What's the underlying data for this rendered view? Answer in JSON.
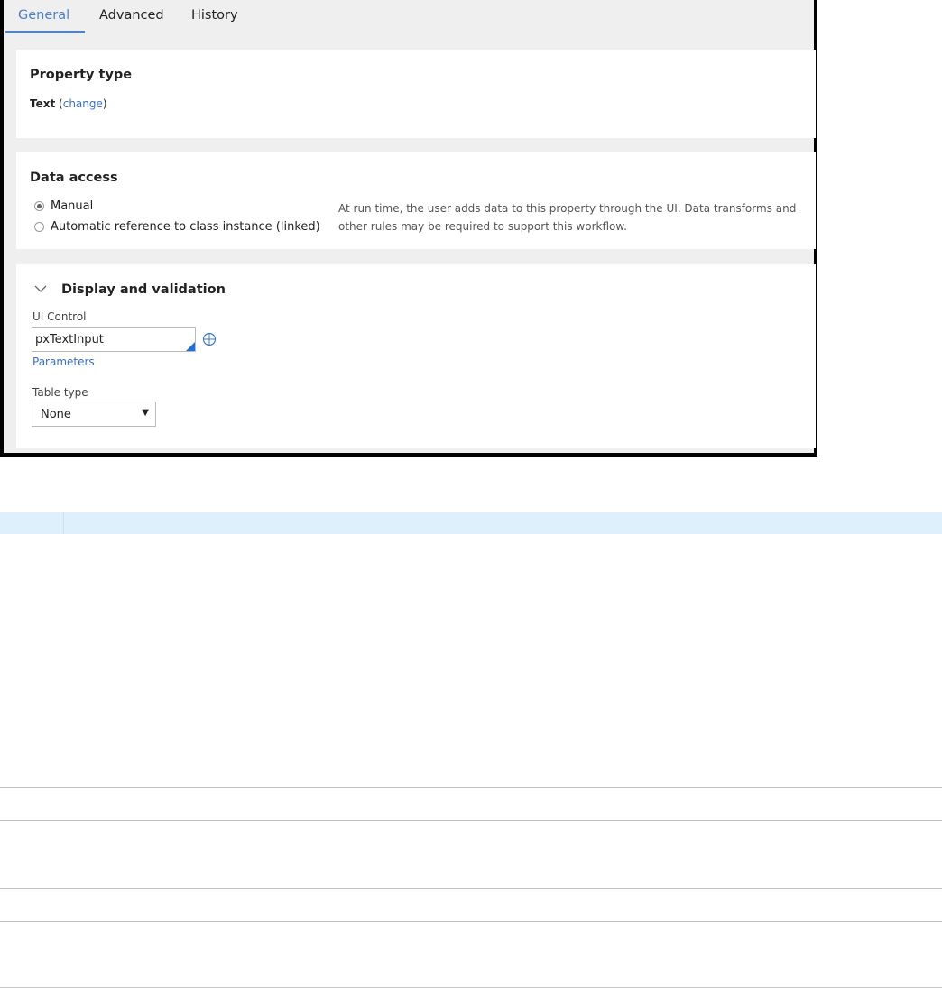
{
  "tabs": [
    {
      "label": "General",
      "active": true
    },
    {
      "label": "Advanced",
      "active": false
    },
    {
      "label": "History",
      "active": false
    }
  ],
  "property_type": {
    "title": "Property type",
    "value": "Text",
    "open_paren": " (",
    "change_link": "change",
    "close_paren": ")"
  },
  "data_access": {
    "title": "Data access",
    "options": [
      {
        "label": "Manual",
        "checked": true
      },
      {
        "label": "Automatic reference to class instance (linked)",
        "checked": false
      }
    ],
    "help_text": "At run time, the user adds data to this property through the UI. Data transforms and other rules may be required to support this workflow."
  },
  "display_validation": {
    "title": "Display and validation",
    "ui_control_label": "UI Control",
    "ui_control_value": "pxTextInput",
    "parameters_link": "Parameters",
    "table_type_label": "Table type",
    "table_type_value": "None"
  },
  "colors": {
    "accent": "#4d80cc",
    "link": "#3a6fc4",
    "card_bg": "#ffffff",
    "frame_bg": "#efefef",
    "highlight_bar": "#ddf0fb"
  },
  "icons": {
    "collapse": "chevron-down-icon",
    "target": "crosshair-target-icon",
    "dropdown": "caret-down-icon"
  }
}
